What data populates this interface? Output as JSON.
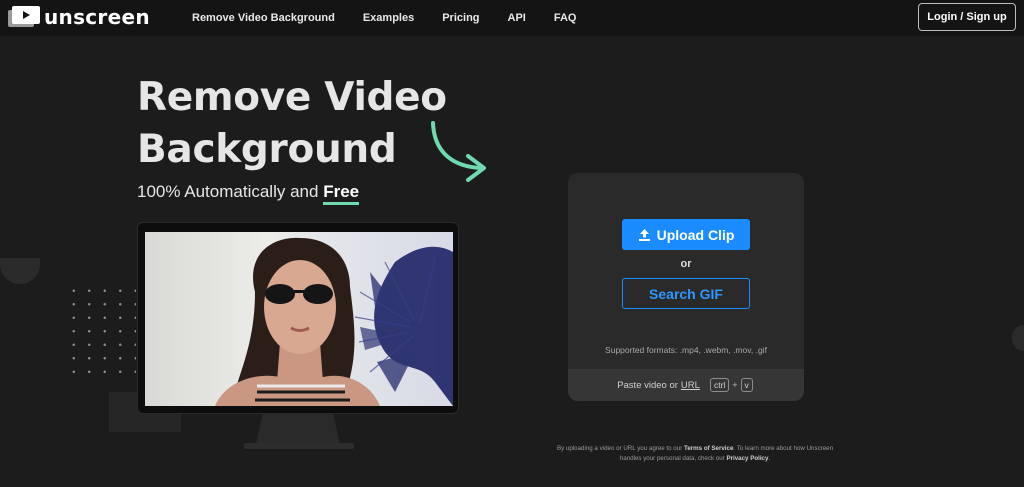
{
  "brand": {
    "name": "unscreen"
  },
  "nav": {
    "links": [
      "Remove Video Background",
      "Examples",
      "Pricing",
      "API",
      "FAQ"
    ],
    "login_label": "Login / Sign up"
  },
  "hero": {
    "title_line1": "Remove Video",
    "title_line2": "Background",
    "subtitle_prefix": "100% Automatically and",
    "subtitle_free": "Free"
  },
  "upload": {
    "upload_label": "Upload Clip",
    "or_label": "or",
    "search_label": "Search GIF",
    "formats": "Supported formats: .mp4, .webm, .mov, .gif",
    "paste_prefix": "Paste video or",
    "paste_url": "URL",
    "key_ctrl": "ctrl",
    "key_plus": "+",
    "key_v": "v"
  },
  "terms": {
    "part1": "By uploading a video or URL you agree to our",
    "tos": "Terms of Service",
    "part2": ". To learn more about how Unscreen handles your personal data, check our",
    "privacy": "Privacy Policy",
    "part3": "."
  },
  "colors": {
    "background": "#1c1c1c",
    "nav": "#141414",
    "accent_blue": "#1a8cff",
    "accent_green": "#6fd9b0",
    "card": "#2a2a2a"
  },
  "icons": [
    "logo-icon",
    "upload-icon",
    "curved-arrow-icon"
  ]
}
